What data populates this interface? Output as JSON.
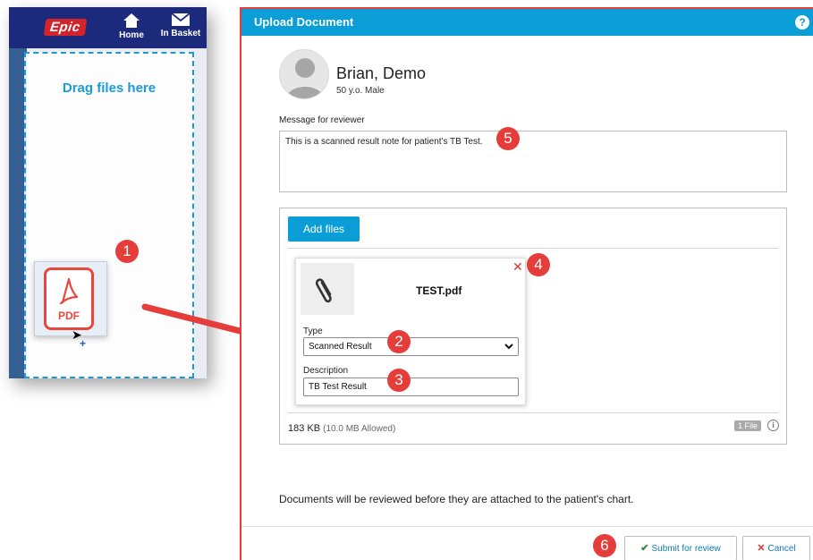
{
  "mobile": {
    "logo": "Epic",
    "nav": [
      {
        "label": "Home",
        "icon": "home-icon"
      },
      {
        "label": "In Basket",
        "icon": "envelope-icon"
      }
    ],
    "dropzone_label": "Drag files here",
    "drag_file_label": "PDF"
  },
  "dialog": {
    "title": "Upload Document",
    "help": "?",
    "patient": {
      "name": "Brian, Demo",
      "age_sex": "50 y.o. Male"
    },
    "message_label": "Message for reviewer",
    "message_value": "This is a scanned result note for patient's TB Test.",
    "add_files_label": "Add files",
    "file": {
      "name": "TEST.pdf",
      "type_label": "Type",
      "type_value": "Scanned Result",
      "description_label": "Description",
      "description_value": "TB Test Result"
    },
    "size": "183 KB",
    "size_allowed": "(10.0 MB Allowed)",
    "file_count": "1 File",
    "notice": "Documents will be reviewed before they are attached to the patient's chart.",
    "submit_label": "Submit for review",
    "cancel_label": "Cancel"
  },
  "badges": [
    "1",
    "2",
    "3",
    "4",
    "5",
    "6"
  ],
  "colors": {
    "accent": "#0b9ed6",
    "badge": "#e43d3a",
    "epic_nav": "#1b2a7a"
  }
}
